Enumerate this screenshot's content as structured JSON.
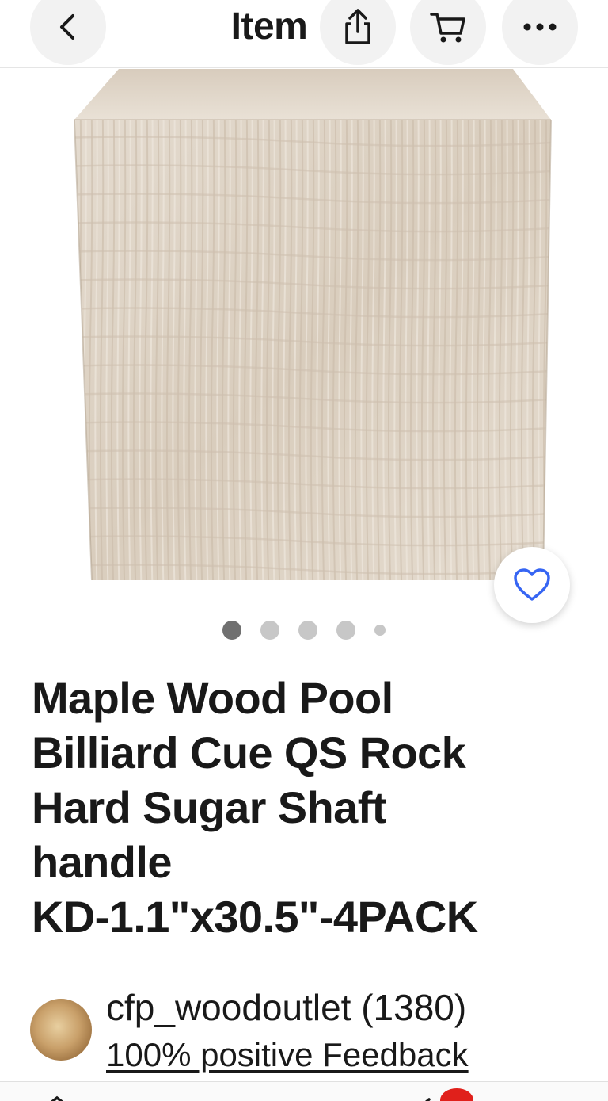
{
  "header": {
    "title": "Item",
    "back_icon": "chevron-left-icon",
    "share_icon": "share-icon",
    "cart_icon": "cart-icon",
    "more_icon": "more-horizontal-icon"
  },
  "gallery": {
    "image_count": 5,
    "active_index": 0,
    "favorite_icon": "heart-icon",
    "accent_color": "#3665f3"
  },
  "product": {
    "title_lines": [
      "Maple Wood Pool",
      "Billiard Cue QS Rock",
      "Hard Sugar Shaft",
      "handle",
      "KD-1.1\"x30.5\"-4PACK"
    ]
  },
  "seller": {
    "name": "cfp_woodoutlet (1380)",
    "feedback": "100% positive Feedback"
  },
  "bottom_nav": {
    "badge_color": "#e0201b"
  }
}
